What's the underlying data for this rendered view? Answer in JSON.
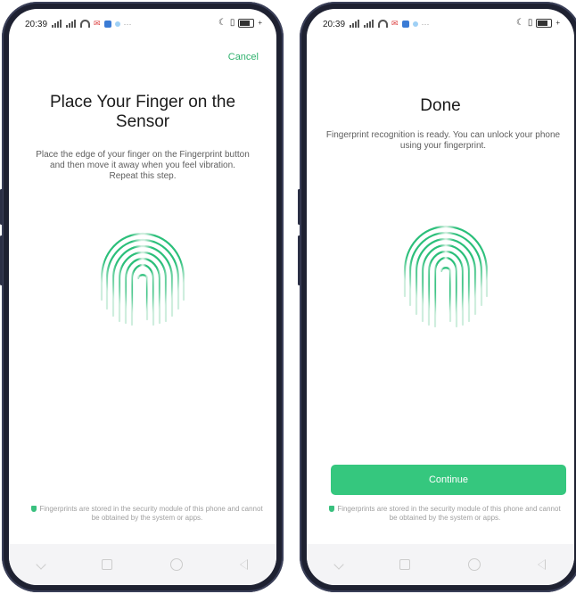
{
  "colors": {
    "accent": "#35c77e",
    "frame": "#1e2131"
  },
  "left_screen": {
    "status": {
      "time": "20:39"
    },
    "cancel_label": "Cancel",
    "title": "Place Your Finger on the Sensor",
    "description": "Place the edge of your finger on the Fingerprint button and then move it away when you feel vibration. Repeat this step.",
    "fingerprint_icon": "fingerprint-icon",
    "notice": "Fingerprints are stored in the security module of this phone and cannot be obtained by the system or apps."
  },
  "right_screen": {
    "status": {
      "time": "20:39"
    },
    "title": "Done",
    "description": "Fingerprint recognition is ready. You can unlock your phone using your fingerprint.",
    "fingerprint_icon": "fingerprint-icon",
    "continue_label": "Continue",
    "notice": "Fingerprints are stored in the security module of this phone and cannot be obtained by the system or apps."
  }
}
